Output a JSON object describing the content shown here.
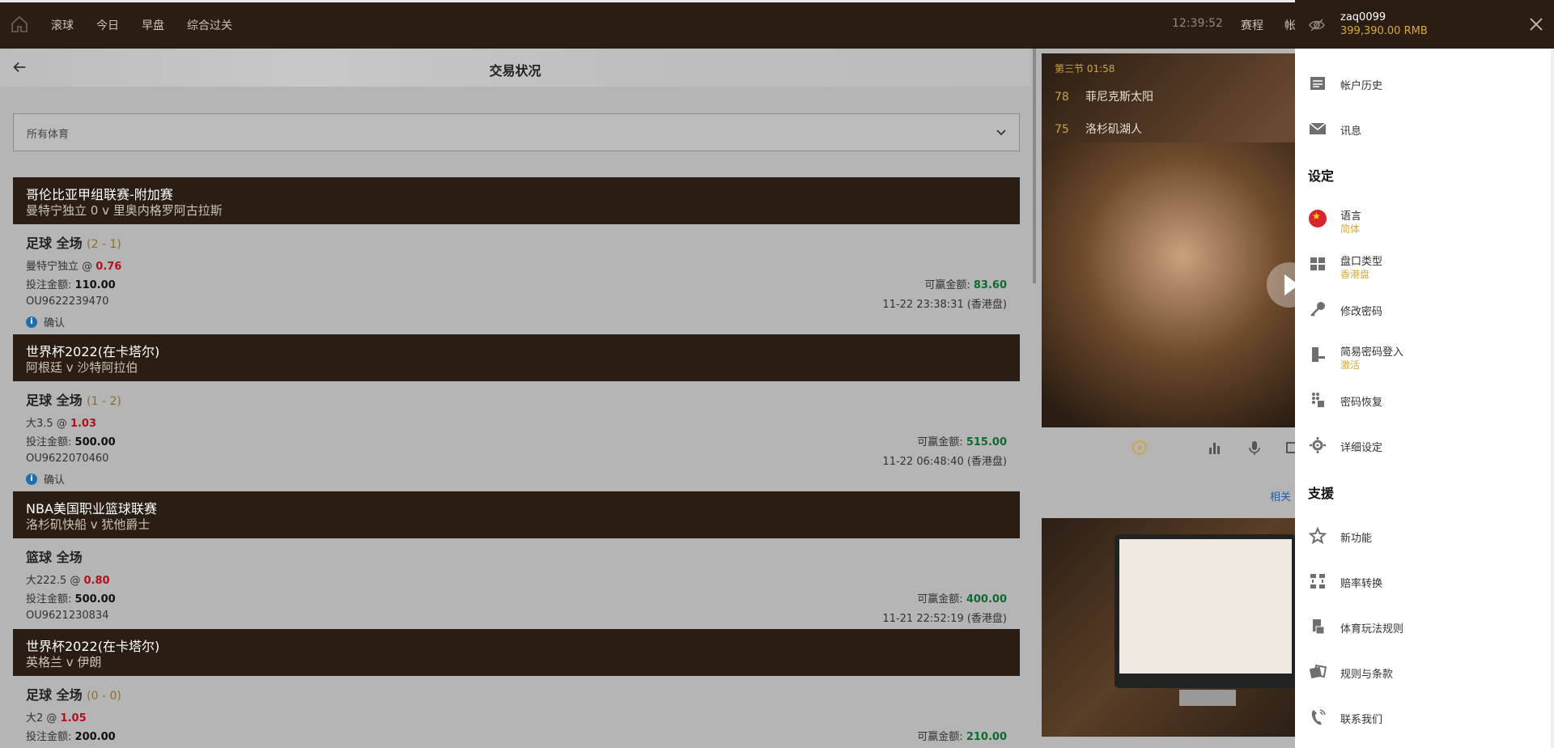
{
  "topbar": {
    "nav": [
      "滚球",
      "今日",
      "早盘",
      "综合过关"
    ],
    "time": "12:39:52",
    "schedule": "赛程",
    "account_trunc": "帐"
  },
  "left": {
    "title": "交易状况",
    "filter_value": "所有体育",
    "bets": [
      {
        "league": "哥伦比亚甲组联赛-附加赛",
        "teams": "曼特宁独立  0  v  里奥内格罗阿古拉斯",
        "sport": "足球 全场",
        "score": "(2 - 1)",
        "pick": "曼特宁独立 @",
        "odds": "0.76",
        "stake_label": "投注金额:",
        "stake": "110.00",
        "win_label": "可赢金额:",
        "win": "83.60",
        "ref": "OU9622239470",
        "date": "11-22 23:38:31 (香港盘)",
        "status": "确认"
      },
      {
        "league": "世界杯2022(在卡塔尔)",
        "teams": "阿根廷   v  沙特阿拉伯",
        "sport": "足球 全场",
        "score": "(1 - 2)",
        "pick": "大3.5 @",
        "odds": "1.03",
        "stake_label": "投注金额:",
        "stake": "500.00",
        "win_label": "可赢金额:",
        "win": "515.00",
        "ref": "OU9622070460",
        "date": "11-22 06:48:40 (香港盘)",
        "status": "确认"
      },
      {
        "league": "NBA美国职业篮球联赛",
        "teams": "洛杉矶快船   v  犹他爵士",
        "sport": "篮球 全场",
        "score": "",
        "pick": "大222.5 @",
        "odds": "0.80",
        "stake_label": "投注金额:",
        "stake": "500.00",
        "win_label": "可赢金额:",
        "win": "400.00",
        "ref": "OU9621230834",
        "date": "11-21 22:52:19 (香港盘)",
        "status": ""
      },
      {
        "league": "世界杯2022(在卡塔尔)",
        "teams": "英格兰   v  伊朗",
        "sport": "足球 全场",
        "score": "(0 - 0)",
        "pick": "大2 @",
        "odds": "1.05",
        "stake_label": "投注金额:",
        "stake": "200.00",
        "win_label": "可赢金额:",
        "win": "210.00",
        "ref": "",
        "date": "",
        "status": ""
      }
    ]
  },
  "video": {
    "period": "第三节 01:58",
    "home_score": "78",
    "home_team": "菲尼克斯太阳",
    "away_score": "75",
    "away_team": "洛杉矶湖人",
    "related": "相关"
  },
  "drawer": {
    "username": "zaq0099",
    "balance": "399,390.00  RMB",
    "items": [
      {
        "label": "帐户历史",
        "icon": "history-icon"
      },
      {
        "label": "讯息",
        "icon": "mail-icon"
      }
    ],
    "section_settings": "设定",
    "language_label": "语言",
    "language_value": "简体",
    "odds_label": "盘口类型",
    "odds_value": "香港盘",
    "change_password": "修改密码",
    "easy_login_label": "简易密码登入",
    "easy_login_value": "激活",
    "password_recovery": "密码恢复",
    "detail_settings": "详细设定",
    "section_support": "支援",
    "new_features": "新功能",
    "odds_conversion": "赔率转换",
    "sports_rules": "体育玩法规则",
    "terms": "规则与条款",
    "contact": "联系我们"
  }
}
